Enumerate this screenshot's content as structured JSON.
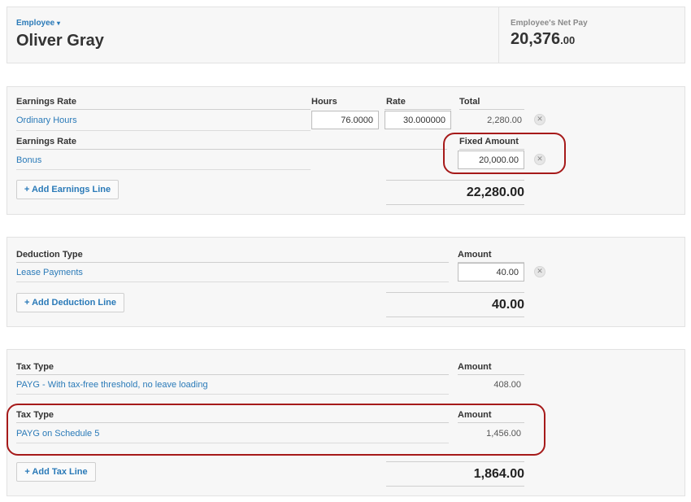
{
  "header": {
    "employee_label": "Employee",
    "employee_name": "Oliver Gray",
    "net_pay_label": "Employee's Net Pay",
    "net_pay_whole": "20,376",
    "net_pay_cents": ".00"
  },
  "earnings": {
    "col_earnings_rate": "Earnings Rate",
    "col_hours": "Hours",
    "col_rate": "Rate",
    "col_total": "Total",
    "row1_name": "Ordinary Hours",
    "row1_hours": "76.0000",
    "row1_rate": "30.000000",
    "row1_total": "2,280.00",
    "col_earnings_rate_2": "Earnings Rate",
    "col_fixed_amount": "Fixed Amount",
    "row2_name": "Bonus",
    "row2_amount": "20,000.00",
    "add_label": "+ Add Earnings Line",
    "total": "22,280.00"
  },
  "deductions": {
    "col_type": "Deduction Type",
    "col_amount": "Amount",
    "row1_name": "Lease Payments",
    "row1_amount": "40.00",
    "add_label": "+ Add Deduction Line",
    "total": "40.00"
  },
  "tax": {
    "col_type": "Tax Type",
    "col_amount": "Amount",
    "row1_name": "PAYG - With tax-free threshold, no leave loading",
    "row1_amount": "408.00",
    "col_type_2": "Tax Type",
    "col_amount_2": "Amount",
    "row2_name": "PAYG on Schedule 5",
    "row2_amount": "1,456.00",
    "add_label": "+ Add Tax Line",
    "total": "1,864.00"
  },
  "icons": {
    "remove": "remove-x-icon",
    "caret": "caret-down-icon"
  },
  "colors": {
    "link": "#2a7ab8",
    "highlight": "#a61a1a",
    "panel_bg": "#f7f7f7"
  }
}
